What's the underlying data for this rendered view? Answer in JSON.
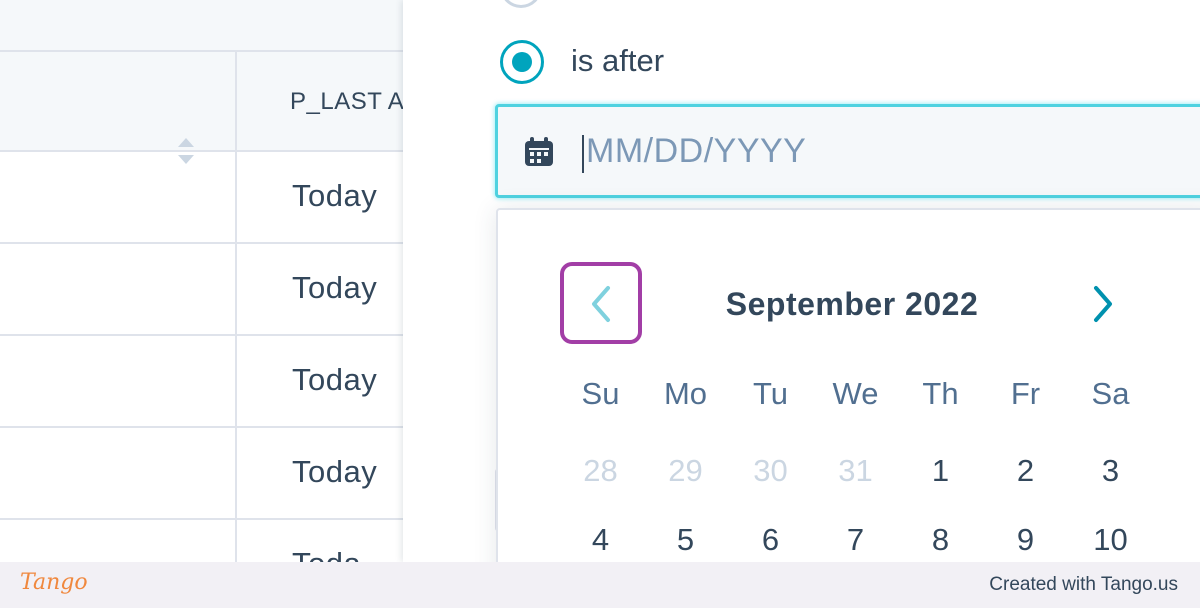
{
  "table": {
    "column_header": "P_LAST A",
    "rows": [
      {
        "value": "Today"
      },
      {
        "value": "Today"
      },
      {
        "value": "Today"
      },
      {
        "value": "Today"
      },
      {
        "value": "Toda"
      }
    ]
  },
  "filter": {
    "radio_label": "is after",
    "radio_selected": true,
    "date_input": {
      "placeholder": "MM/DD/YYYY",
      "value": ""
    }
  },
  "calendar": {
    "month_title": "September 2022",
    "weekdays": [
      "Su",
      "Mo",
      "Tu",
      "We",
      "Th",
      "Fr",
      "Sa"
    ],
    "week_1": [
      "28",
      "29",
      "30",
      "31",
      "1",
      "2",
      "3"
    ],
    "week_2": [
      "4",
      "5",
      "6",
      "7",
      "8",
      "9",
      "10"
    ],
    "outside_month_days": [
      "28",
      "29",
      "30",
      "31"
    ]
  },
  "icons": {
    "sort": "sort-icon",
    "calendar": "calendar-icon",
    "prev": "chevron-left-icon",
    "next": "chevron-right-icon"
  },
  "colors": {
    "accent": "#00a4bd",
    "highlight": "#a23ea6",
    "text": "#33475b",
    "muted": "#cbd6e2",
    "brand": "#f0883e"
  },
  "footer": {
    "brand": "Tango",
    "credit": "Created with Tango.us"
  }
}
